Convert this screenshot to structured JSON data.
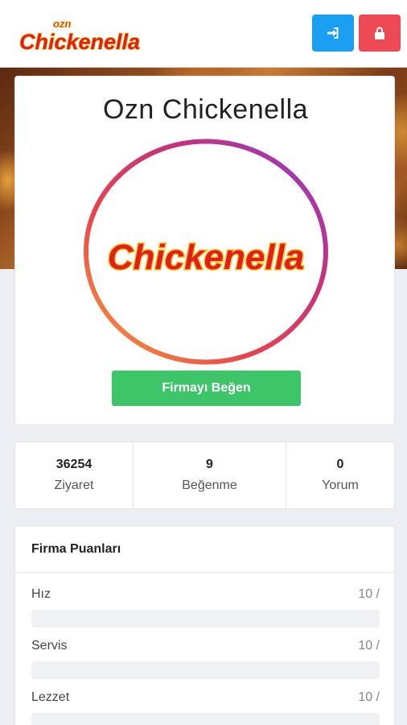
{
  "header": {
    "logo_text": "ozn Chickenella",
    "login_icon": "sign-in-icon",
    "register_icon": "lock-icon",
    "login_color": "#1a9ff1",
    "register_color": "#ee4a55"
  },
  "profile": {
    "company_name": "Ozn Chickenella",
    "logo_text": "Chickenella",
    "like_button_label": "Firmayı Beğen",
    "like_button_color": "#3ec56a"
  },
  "stats": [
    {
      "value": "36254",
      "label": "Ziyaret"
    },
    {
      "value": "9",
      "label": "Beğenme"
    },
    {
      "value": "0",
      "label": "Yorum"
    }
  ],
  "ratings": {
    "title": "Firma Puanları",
    "items": [
      {
        "name": "Hız",
        "score": "10 /",
        "fill": 0
      },
      {
        "name": "Servis",
        "score": "10 /",
        "fill": 0
      },
      {
        "name": "Lezzet",
        "score": "10 /",
        "fill": 0
      }
    ]
  }
}
